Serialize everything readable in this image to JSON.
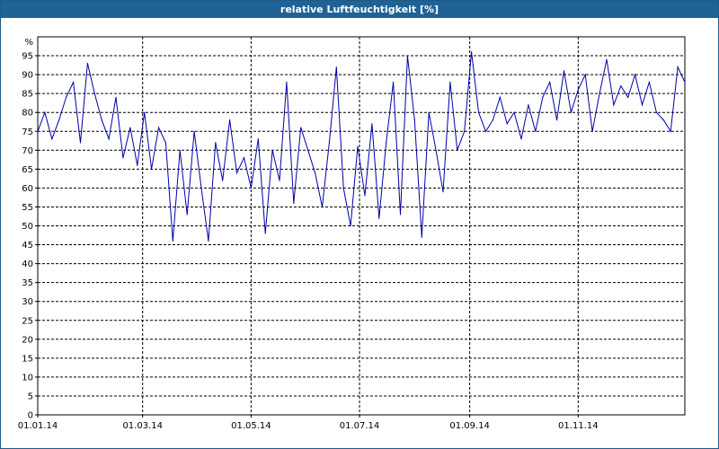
{
  "window": {
    "title": "relative Luftfeuchtigkeit [%]"
  },
  "chart_data": {
    "type": "line",
    "title": "relative Luftfeuchtigkeit [%]",
    "ylabel": "%",
    "ylim": [
      0,
      100
    ],
    "y_ticks": [
      0,
      5,
      10,
      15,
      20,
      25,
      30,
      35,
      40,
      45,
      50,
      55,
      60,
      65,
      70,
      75,
      80,
      85,
      90,
      95
    ],
    "xlim": [
      "2014-01-01",
      "2014-12-31"
    ],
    "x_ticks": [
      {
        "date": "2014-01-01",
        "label": "01.01.14"
      },
      {
        "date": "2014-03-01",
        "label": "01.03.14"
      },
      {
        "date": "2014-05-01",
        "label": "01.05.14"
      },
      {
        "date": "2014-07-01",
        "label": "01.07.14"
      },
      {
        "date": "2014-09-01",
        "label": "01.09.14"
      },
      {
        "date": "2014-11-01",
        "label": "01.11.14"
      }
    ],
    "grid": true,
    "colors": {
      "line": "#0000a8",
      "grid": "#000000"
    },
    "series": [
      {
        "x": [
          "2014-01-01",
          "2014-01-05",
          "2014-01-09",
          "2014-01-13",
          "2014-01-17",
          "2014-01-21",
          "2014-01-25",
          "2014-01-29",
          "2014-02-02",
          "2014-02-06",
          "2014-02-10",
          "2014-02-14",
          "2014-02-18",
          "2014-02-22",
          "2014-02-26",
          "2014-03-02",
          "2014-03-06",
          "2014-03-10",
          "2014-03-14",
          "2014-03-18",
          "2014-03-22",
          "2014-03-26",
          "2014-03-30",
          "2014-04-03",
          "2014-04-07",
          "2014-04-11",
          "2014-04-15",
          "2014-04-19",
          "2014-04-23",
          "2014-04-27",
          "2014-05-01",
          "2014-05-05",
          "2014-05-09",
          "2014-05-13",
          "2014-05-17",
          "2014-05-21",
          "2014-05-25",
          "2014-05-29",
          "2014-06-02",
          "2014-06-06",
          "2014-06-10",
          "2014-06-14",
          "2014-06-18",
          "2014-06-22",
          "2014-06-26",
          "2014-06-30",
          "2014-07-04",
          "2014-07-08",
          "2014-07-12",
          "2014-07-16",
          "2014-07-20",
          "2014-07-24",
          "2014-07-28",
          "2014-08-01",
          "2014-08-05",
          "2014-08-09",
          "2014-08-13",
          "2014-08-17",
          "2014-08-21",
          "2014-08-25",
          "2014-08-29",
          "2014-09-02",
          "2014-09-06",
          "2014-09-10",
          "2014-09-14",
          "2014-09-18",
          "2014-09-22",
          "2014-09-26",
          "2014-09-30",
          "2014-10-04",
          "2014-10-08",
          "2014-10-12",
          "2014-10-16",
          "2014-10-20",
          "2014-10-24",
          "2014-10-28",
          "2014-11-01",
          "2014-11-05",
          "2014-11-09",
          "2014-11-13",
          "2014-11-17",
          "2014-11-21",
          "2014-11-25",
          "2014-11-29",
          "2014-12-03",
          "2014-12-07",
          "2014-12-11",
          "2014-12-15",
          "2014-12-19",
          "2014-12-23",
          "2014-12-27",
          "2014-12-31"
        ],
        "values": [
          75,
          80,
          73,
          78,
          84,
          88,
          72,
          93,
          85,
          78,
          73,
          84,
          68,
          76,
          66,
          80,
          65,
          76,
          72,
          46,
          70,
          53,
          75,
          60,
          46,
          72,
          62,
          78,
          64,
          68,
          60,
          73,
          48,
          70,
          62,
          88,
          56,
          76,
          70,
          64,
          55,
          72,
          92,
          60,
          50,
          71,
          58,
          77,
          52,
          72,
          88,
          53,
          95,
          78,
          47,
          80,
          70,
          59,
          88,
          70,
          75,
          96,
          80,
          75,
          78,
          84,
          77,
          80,
          73,
          82,
          75,
          84,
          88,
          78,
          91,
          80,
          86,
          90,
          75,
          85,
          94,
          82,
          87,
          84,
          90,
          82,
          88,
          80,
          78,
          75,
          92,
          88
        ]
      }
    ]
  }
}
